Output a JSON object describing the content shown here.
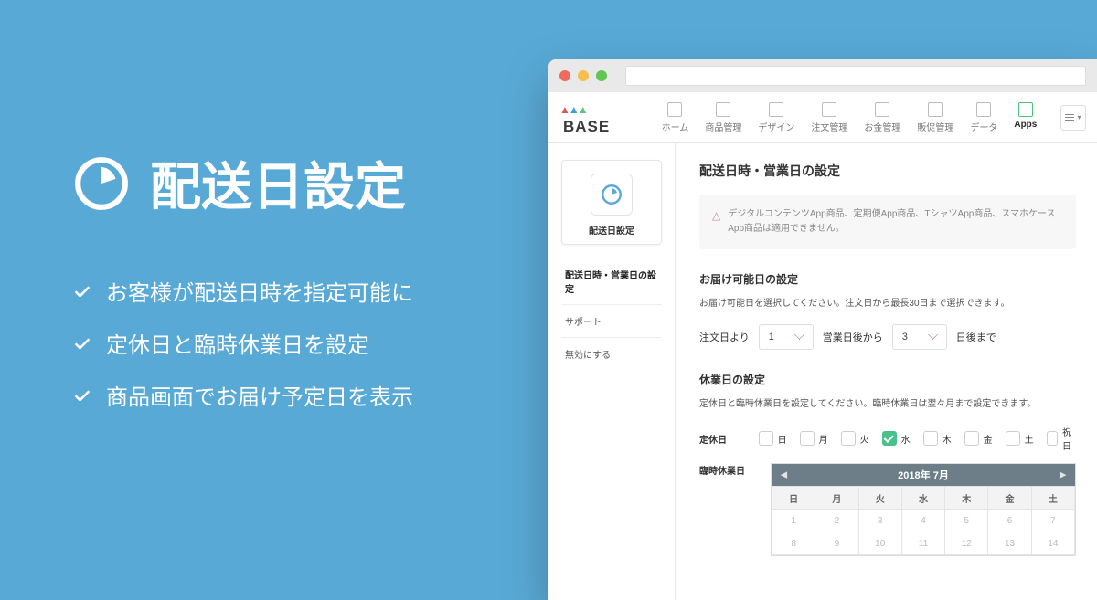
{
  "marketing": {
    "title": "配送日設定",
    "features": [
      "お客様が配送日時を指定可能に",
      "定休日と臨時休業日を設定",
      "商品画面でお届け予定日を表示"
    ]
  },
  "brand": "BASE",
  "nav": {
    "items": [
      {
        "label": "ホーム"
      },
      {
        "label": "商品管理"
      },
      {
        "label": "デザイン"
      },
      {
        "label": "注文管理"
      },
      {
        "label": "お金管理"
      },
      {
        "label": "販促管理"
      },
      {
        "label": "データ"
      },
      {
        "label": "Apps",
        "active": true
      }
    ]
  },
  "sidebar": {
    "card_title": "配送日設定",
    "items": [
      {
        "label": "配送日時・営業日の設定",
        "active": true
      },
      {
        "label": "サポート"
      },
      {
        "label": "無効にする"
      }
    ]
  },
  "panel": {
    "title": "配送日時・営業日の設定",
    "alert": "デジタルコンテンツApp商品、定期便App商品、TシャツApp商品、スマホケースApp商品は適用できません。",
    "section1": {
      "heading": "お届け可能日の設定",
      "desc": "お届け可能日を選択してください。注文日から最長30日まで選択できます。",
      "from_label": "注文日より",
      "from_value": "1",
      "to_label": "営業日後から",
      "to_value": "3",
      "suffix": "日後まで"
    },
    "section2": {
      "heading": "休業日の設定",
      "desc": "定休日と臨時休業日を設定してください。臨時休業日は翌々月まで設定できます。",
      "regular_label": "定休日",
      "days": [
        {
          "label": "日",
          "on": false
        },
        {
          "label": "月",
          "on": false
        },
        {
          "label": "火",
          "on": false
        },
        {
          "label": "水",
          "on": true
        },
        {
          "label": "木",
          "on": false
        },
        {
          "label": "金",
          "on": false
        },
        {
          "label": "土",
          "on": false
        },
        {
          "label": "祝日",
          "on": false
        }
      ],
      "temp_label": "臨時休業日"
    },
    "calendar": {
      "title": "2018年 7月",
      "weekdays": [
        "日",
        "月",
        "火",
        "水",
        "木",
        "金",
        "土"
      ],
      "rows": [
        [
          "1",
          "2",
          "3",
          "4",
          "5",
          "6",
          "7"
        ],
        [
          "8",
          "9",
          "10",
          "11",
          "12",
          "13",
          "14"
        ]
      ]
    }
  }
}
